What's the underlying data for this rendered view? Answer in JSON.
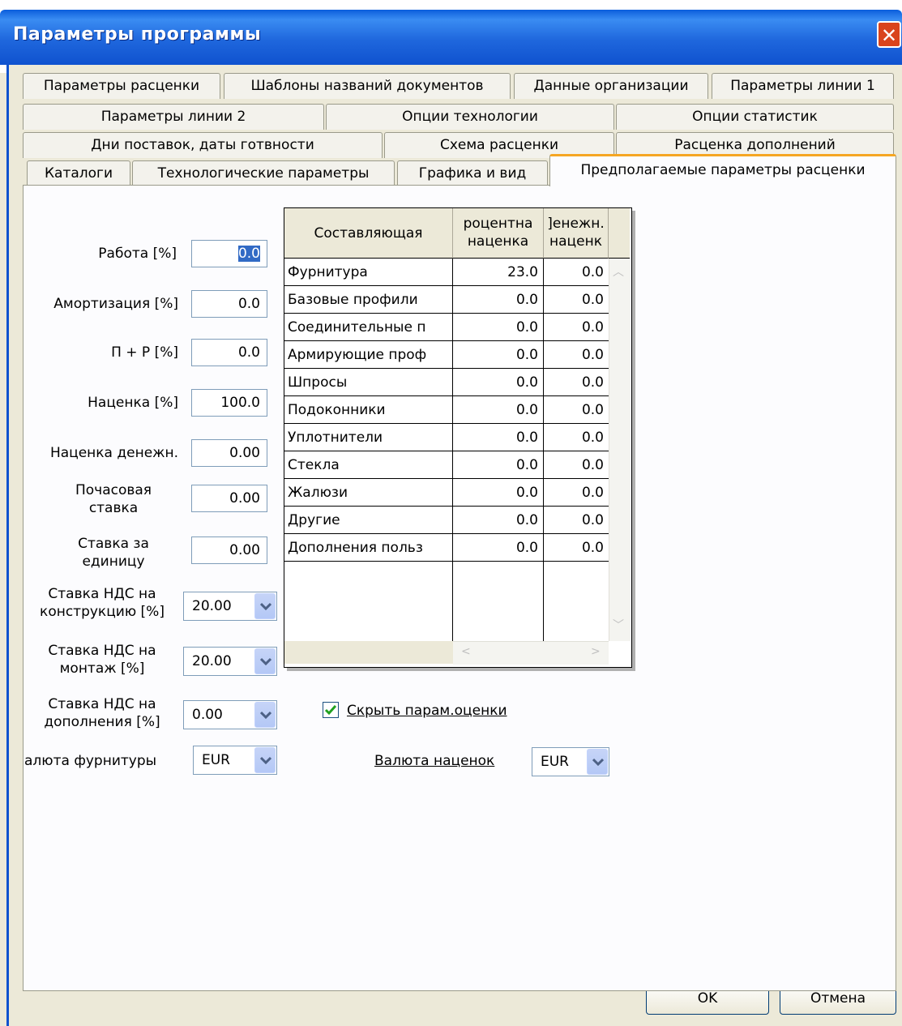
{
  "window": {
    "title": "Параметры программы",
    "close_label": "✕"
  },
  "tabs": {
    "row1": [
      "Параметры расценки",
      "Шаблоны названий документов",
      "Данные организации",
      "Параметры линии 1"
    ],
    "row2": [
      "Параметры линии 2",
      "Опции технологии",
      "Опции статистик"
    ],
    "row3": [
      "Дни поставок, даты готвности",
      "Схема расценки",
      "Расценка дополнений"
    ],
    "row4": [
      "Каталоги",
      "Технологические параметры",
      "Графика и вид",
      "Предполагаемые параметры расценки"
    ]
  },
  "form": {
    "work": {
      "label": "Работа [%]",
      "value": "0.0"
    },
    "amort": {
      "label": "Амортизация [%]",
      "value": "0.0"
    },
    "pr": {
      "label": "П + Р [%]",
      "value": "0.0"
    },
    "markup": {
      "label": "Наценка [%]",
      "value": "100.0"
    },
    "markup_money": {
      "label": "Наценка денежн.",
      "value": "0.00"
    },
    "hourly_rate": {
      "label_line1": "Почасовая",
      "label_line2": "ставка",
      "value": "0.00"
    },
    "unit_rate": {
      "label_line1": "Ставка за",
      "label_line2": "единицу",
      "value": "0.00"
    },
    "vat_construction": {
      "label_line1": "Ставка НДС на",
      "label_line2": "конструкцию [%]",
      "value": "20.00"
    },
    "vat_install": {
      "label_line1": "Ставка НДС на",
      "label_line2": "монтаж [%]",
      "value": "20.00"
    },
    "vat_additions": {
      "label_line1": "Ставка НДС на",
      "label_line2": "дополнения [%]",
      "value": "0.00"
    },
    "hardware_currency": {
      "label": "алюта фурнитуры",
      "value": "EUR"
    },
    "markup_currency": {
      "label": "Валюта наценок",
      "value": "EUR"
    },
    "hide_params": {
      "label": "Скрыть парам.оценки",
      "checked": true
    }
  },
  "table": {
    "headers": {
      "component": "Составляющая",
      "pct_line1": "роцентна",
      "pct_line2": "наценка",
      "money_line1": "]енежн.",
      "money_line2": "наценк"
    },
    "rows": [
      {
        "name": "Фурнитура",
        "pct": "23.0",
        "money": "0.0"
      },
      {
        "name": "Базовые профили",
        "pct": "0.0",
        "money": "0.0"
      },
      {
        "name": "Соединительные п",
        "pct": "0.0",
        "money": "0.0"
      },
      {
        "name": "Армирующие проф",
        "pct": "0.0",
        "money": "0.0"
      },
      {
        "name": "Шпросы",
        "pct": "0.0",
        "money": "0.0"
      },
      {
        "name": "Подоконники",
        "pct": "0.0",
        "money": "0.0"
      },
      {
        "name": "Уплотнители",
        "pct": "0.0",
        "money": "0.0"
      },
      {
        "name": "Стекла",
        "pct": "0.0",
        "money": "0.0"
      },
      {
        "name": "Жалюзи",
        "pct": "0.0",
        "money": "0.0"
      },
      {
        "name": "Другие",
        "pct": "0.0",
        "money": "0.0"
      },
      {
        "name": "Дополнения польз",
        "pct": "0.0",
        "money": "0.0"
      }
    ]
  },
  "buttons": {
    "ok": "OK",
    "cancel": "Отмена"
  },
  "colors": {
    "titlebar": "#0f52cf",
    "face": "#ece9d8",
    "active_tab_accent": "#f5a623",
    "close": "#d9441c"
  }
}
